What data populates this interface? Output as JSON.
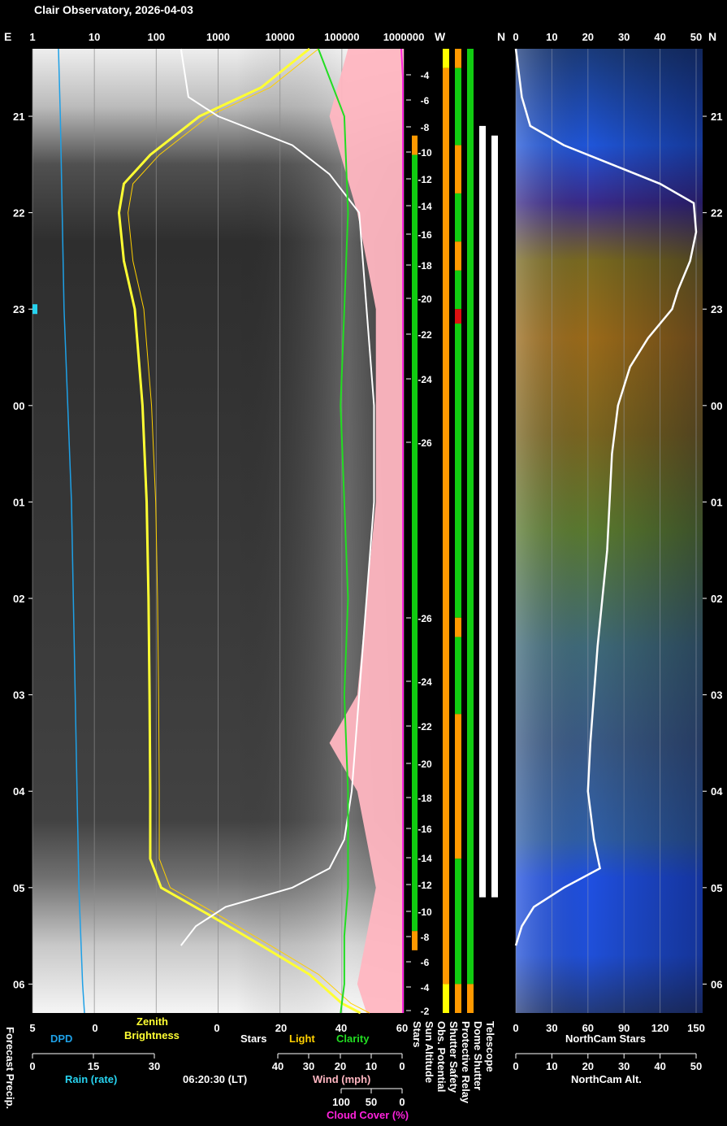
{
  "title": "Clair Observatory, 2026-04-03",
  "timestamp": "06:20:30 (LT)",
  "colors": {
    "background": "#000000",
    "dpd": "#1ea0e6",
    "rain": "#27d3f0",
    "zenith": "#ffff33",
    "light": "#ffd000",
    "clarity": "#22dd22",
    "wind": "#ffb6c1",
    "cloud": "#ff22dd",
    "stars": "#ffffff",
    "status_ok": "#11cc11",
    "status_warn": "#ff9900",
    "status_bad": "#dd1111",
    "status_caution": "#ffff00"
  },
  "chart_data": [
    {
      "type": "line",
      "panel": "main",
      "top_axis": {
        "left_letter": "E",
        "ticks": [
          "1",
          "10",
          "100",
          "1000",
          "10000",
          "100000",
          "1000000"
        ],
        "scale": "log"
      },
      "time_axis": {
        "ticks": [
          "21",
          "22",
          "23",
          "00",
          "01",
          "02",
          "03",
          "04",
          "05",
          "06"
        ],
        "direction": "top-to-bottom"
      },
      "sun_altitude_ticks": [
        "-4",
        "-6",
        "-8",
        "-10",
        "-12",
        "-14",
        "-16",
        "-18",
        "-20",
        "-22",
        "-24",
        "-26",
        "-26",
        "-24",
        "-22",
        "-20",
        "-18",
        "-16",
        "-14",
        "-12",
        "-10",
        "-8",
        "-6",
        "-4",
        "-2"
      ],
      "bottom_axes": [
        {
          "name": "DPD",
          "ticks": [
            "5",
            "0"
          ]
        },
        {
          "name": "Zenith Brightness",
          "label": "Zenith\nBrightness",
          "ticks": [
            "20"
          ]
        },
        {
          "name": "Stars",
          "ticks": [
            "0"
          ]
        },
        {
          "name": "Light",
          "ticks": [
            "20"
          ]
        },
        {
          "name": "Clarity",
          "ticks": [
            "40",
            "60"
          ]
        },
        {
          "name": "Rain (rate)",
          "ticks": [
            "0",
            "15",
            "30"
          ]
        },
        {
          "name": "Wind (mph)",
          "ticks": [
            "40",
            "30",
            "20",
            "10",
            "0"
          ]
        },
        {
          "name": "Cloud Cover (%)",
          "ticks": [
            "100",
            "50",
            "0"
          ]
        }
      ],
      "series": [
        {
          "name": "DPD",
          "x": [
            20.3,
            21,
            22,
            23,
            0,
            1,
            2,
            3,
            4,
            5,
            6,
            6.3
          ],
          "values": [
            3.6,
            3.5,
            3.4,
            3.3,
            3.1,
            2.9,
            2.8,
            2.7,
            2.6,
            2.5,
            2.3,
            2.2
          ]
        },
        {
          "name": "Zenith Brightness",
          "x": [
            20.3,
            20.7,
            21,
            21.4,
            21.7,
            22,
            22.5,
            23,
            0,
            1,
            2,
            3,
            4,
            4.7,
            5,
            5.3,
            5.6,
            5.9,
            6.2,
            6.3
          ],
          "values": [
            30000,
            5000,
            500,
            80,
            30,
            25,
            30,
            45,
            60,
            70,
            75,
            78,
            80,
            80,
            120,
            800,
            5000,
            30000,
            100000,
            200000
          ]
        },
        {
          "name": "Stars",
          "x": [
            20.3,
            20.8,
            21,
            21.3,
            21.6,
            22,
            23,
            0,
            1,
            2,
            3,
            4,
            4.5,
            4.8,
            5,
            5.2,
            5.4,
            5.6
          ],
          "values": [
            0,
            2,
            10,
            30,
            40,
            48,
            50,
            52,
            52,
            50,
            48,
            46,
            44,
            40,
            30,
            12,
            4,
            0
          ]
        },
        {
          "name": "Clarity",
          "x": [
            20.3,
            20.6,
            21,
            22,
            23,
            0,
            1,
            2,
            3,
            4,
            5,
            5.5,
            6,
            6.3
          ],
          "values": [
            37,
            40,
            44,
            45,
            44,
            43,
            44,
            45,
            44,
            45,
            45,
            44,
            44,
            43
          ]
        },
        {
          "name": "Wind (mph)",
          "x": [
            20.3,
            21,
            22,
            23,
            0,
            1,
            2,
            3,
            3.5,
            4,
            5,
            6,
            6.3
          ],
          "values": [
            6,
            8,
            5,
            3,
            3,
            3,
            4,
            5,
            8,
            5,
            3,
            5,
            4
          ]
        },
        {
          "name": "Cloud Cover (%)",
          "x": [
            20.3,
            20.6,
            21,
            23,
            2,
            5,
            6.3
          ],
          "values": [
            2,
            0,
            0,
            0,
            0,
            0,
            0
          ]
        }
      ]
    },
    {
      "type": "heatmap",
      "panel": "status",
      "column_labels": [
        "Sun Altitude",
        "Obs. Potential",
        "Shutter Safety",
        "Protective Relay",
        "Dome Shutter",
        "Telescope"
      ],
      "segments": {
        "Sun Altitude": [
          {
            "start": 20.3,
            "end": 21.2,
            "state": "off"
          },
          {
            "start": 21.2,
            "end": 21.4,
            "state": "warn"
          },
          {
            "start": 21.4,
            "end": 5.45,
            "state": "ok"
          },
          {
            "start": 5.45,
            "end": 5.65,
            "state": "warn"
          },
          {
            "start": 5.65,
            "end": 6.3,
            "state": "off"
          }
        ],
        "Obs. Potential": [
          {
            "start": 20.3,
            "end": 20.5,
            "state": "caution"
          },
          {
            "start": 20.5,
            "end": 6.0,
            "state": "warn"
          },
          {
            "start": 6.0,
            "end": 6.3,
            "state": "caution"
          }
        ],
        "Shutter Safety": [
          {
            "start": 20.3,
            "end": 20.5,
            "state": "warn"
          },
          {
            "start": 20.5,
            "end": 21.3,
            "state": "ok"
          },
          {
            "start": 21.3,
            "end": 21.8,
            "state": "warn"
          },
          {
            "start": 21.8,
            "end": 22.3,
            "state": "ok"
          },
          {
            "start": 22.3,
            "end": 22.6,
            "state": "warn"
          },
          {
            "start": 22.6,
            "end": 23.0,
            "state": "ok"
          },
          {
            "start": 23.0,
            "end": 23.15,
            "state": "bad"
          },
          {
            "start": 23.15,
            "end": 2.2,
            "state": "ok"
          },
          {
            "start": 2.2,
            "end": 2.4,
            "state": "warn"
          },
          {
            "start": 2.4,
            "end": 3.2,
            "state": "ok"
          },
          {
            "start": 3.2,
            "end": 4.7,
            "state": "warn"
          },
          {
            "start": 4.7,
            "end": 6.0,
            "state": "ok"
          },
          {
            "start": 6.0,
            "end": 6.3,
            "state": "warn"
          }
        ],
        "Protective Relay": [
          {
            "start": 20.3,
            "end": 6.0,
            "state": "ok"
          },
          {
            "start": 6.0,
            "end": 6.3,
            "state": "warn"
          }
        ],
        "Dome Shutter": [
          {
            "start": 21.1,
            "end": 5.1,
            "state": "open"
          }
        ],
        "Telescope": [
          {
            "start": 21.2,
            "end": 5.1,
            "state": "tracking"
          }
        ]
      }
    },
    {
      "type": "line",
      "panel": "northcam",
      "top_axis": {
        "left_letter": "W",
        "right_letters": [
          "N",
          "N"
        ],
        "ticks": [
          "0",
          "10",
          "20",
          "30",
          "40",
          "50"
        ]
      },
      "bottom_axes": [
        {
          "name": "NorthCam Stars",
          "ticks": [
            "0",
            "30",
            "60",
            "90",
            "120",
            "150"
          ]
        },
        {
          "name": "NorthCam Alt.",
          "ticks": [
            "0",
            "10",
            "20",
            "30",
            "40",
            "50"
          ]
        }
      ],
      "series": [
        {
          "name": "NorthCam Stars",
          "x": [
            20.3,
            20.8,
            21.1,
            21.3,
            21.5,
            21.7,
            21.9,
            22.2,
            22.5,
            22.8,
            23.0,
            23.3,
            23.6,
            0,
            0.5,
            1,
            1.5,
            2,
            2.5,
            3,
            3.5,
            4,
            4.5,
            4.8,
            5.0,
            5.2,
            5.4,
            5.6
          ],
          "values": [
            0,
            5,
            12,
            40,
            80,
            120,
            148,
            150,
            145,
            135,
            130,
            110,
            95,
            85,
            80,
            78,
            76,
            72,
            68,
            65,
            62,
            60,
            65,
            70,
            40,
            15,
            5,
            0
          ]
        }
      ]
    }
  ],
  "labels": {
    "dpd": "DPD",
    "zenith": "Zenith\nBrightness",
    "stars": "Stars",
    "light": "Light",
    "clarity": "Clarity",
    "rain": "Rain (rate)",
    "wind": "Wind (mph)",
    "cloud": "Cloud Cover (%)",
    "forecast": "Forecast Precip.",
    "northcam_stars": "NorthCam Stars",
    "northcam_alt": "NorthCam Alt."
  }
}
